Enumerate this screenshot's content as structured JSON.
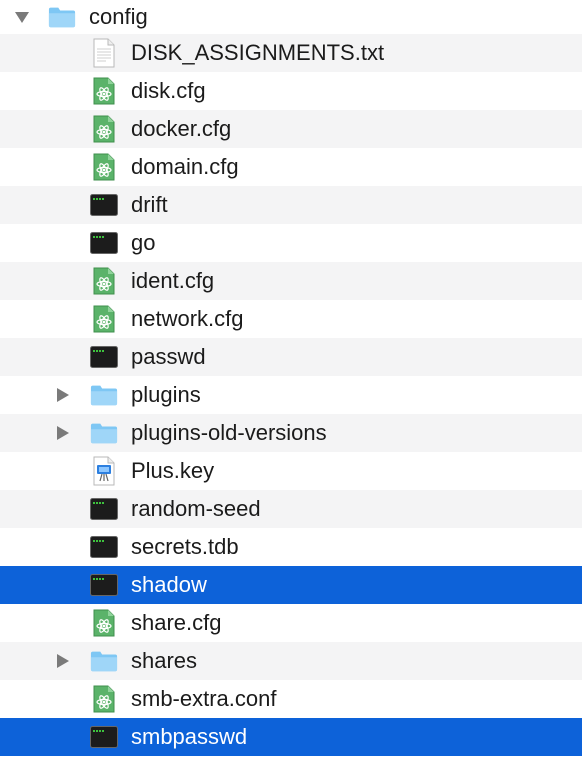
{
  "root": {
    "name": "config",
    "expanded": true,
    "icon": "folder-icon"
  },
  "colors": {
    "selection": "#0d62d9",
    "stripe": "#f4f4f5",
    "folder": "#7ec7f4",
    "terminal": "#1c1c1c",
    "cfg": "#5bb36a"
  },
  "items": [
    {
      "name": "DISK_ASSIGNMENTS.txt",
      "icon": "text-document-icon",
      "folder": false,
      "selected": false
    },
    {
      "name": "disk.cfg",
      "icon": "atom-config-icon",
      "folder": false,
      "selected": false
    },
    {
      "name": "docker.cfg",
      "icon": "atom-config-icon",
      "folder": false,
      "selected": false
    },
    {
      "name": "domain.cfg",
      "icon": "atom-config-icon",
      "folder": false,
      "selected": false
    },
    {
      "name": "drift",
      "icon": "terminal-exec-icon",
      "folder": false,
      "selected": false
    },
    {
      "name": "go",
      "icon": "terminal-exec-icon",
      "folder": false,
      "selected": false
    },
    {
      "name": "ident.cfg",
      "icon": "atom-config-icon",
      "folder": false,
      "selected": false
    },
    {
      "name": "network.cfg",
      "icon": "atom-config-icon",
      "folder": false,
      "selected": false
    },
    {
      "name": "passwd",
      "icon": "terminal-exec-icon",
      "folder": false,
      "selected": false
    },
    {
      "name": "plugins",
      "icon": "folder-icon",
      "folder": true,
      "selected": false
    },
    {
      "name": "plugins-old-versions",
      "icon": "folder-icon",
      "folder": true,
      "selected": false
    },
    {
      "name": "Plus.key",
      "icon": "keynote-icon",
      "folder": false,
      "selected": false
    },
    {
      "name": "random-seed",
      "icon": "terminal-exec-icon",
      "folder": false,
      "selected": false
    },
    {
      "name": "secrets.tdb",
      "icon": "terminal-exec-icon",
      "folder": false,
      "selected": false
    },
    {
      "name": "shadow",
      "icon": "terminal-exec-icon",
      "folder": false,
      "selected": true
    },
    {
      "name": "share.cfg",
      "icon": "atom-config-icon",
      "folder": false,
      "selected": false
    },
    {
      "name": "shares",
      "icon": "folder-icon",
      "folder": true,
      "selected": false
    },
    {
      "name": "smb-extra.conf",
      "icon": "atom-config-icon",
      "folder": false,
      "selected": false
    },
    {
      "name": "smbpasswd",
      "icon": "terminal-exec-icon",
      "folder": false,
      "selected": true
    }
  ]
}
